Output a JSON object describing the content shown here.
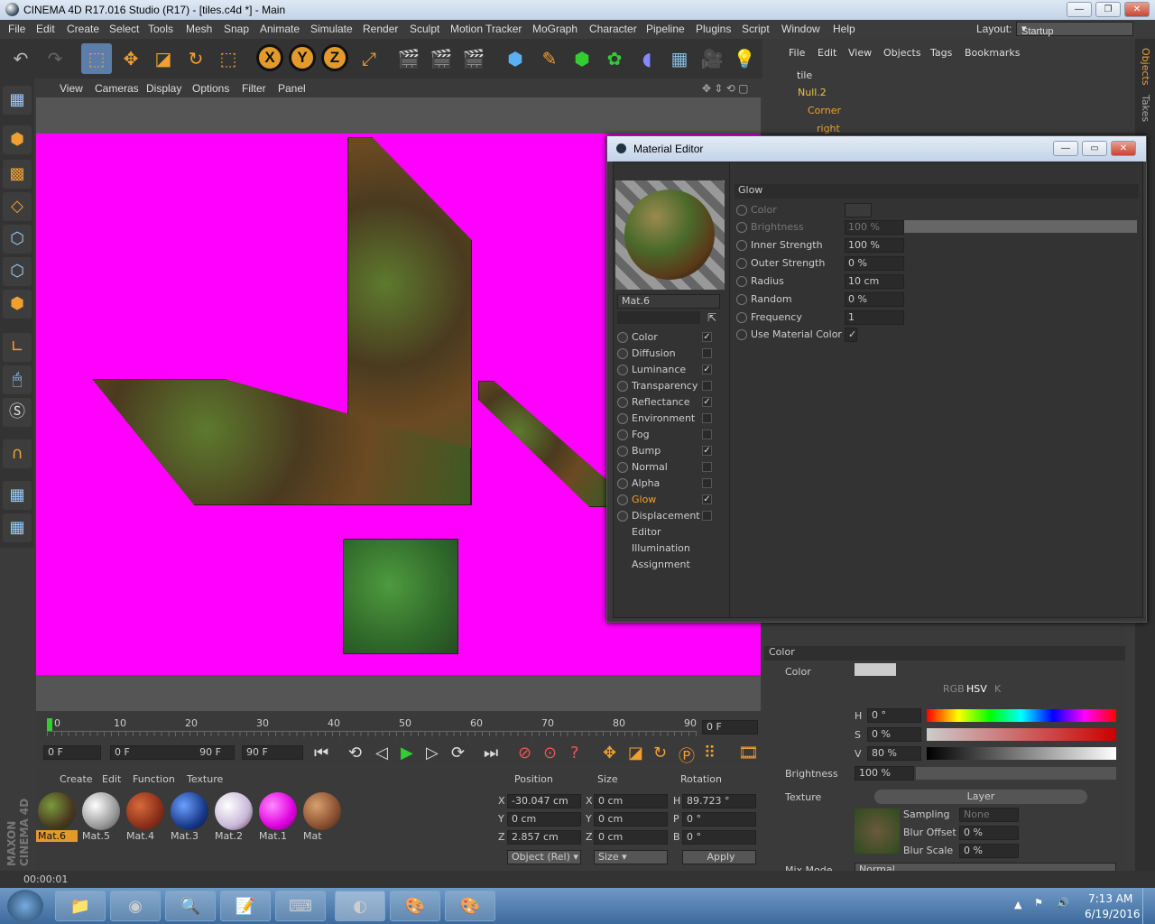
{
  "window": {
    "title": "CINEMA 4D R17.016 Studio (R17) - [tiles.c4d *] - Main"
  },
  "menubar": {
    "items": [
      "File",
      "Edit",
      "Create",
      "Select",
      "Tools",
      "Mesh",
      "Snap",
      "Animate",
      "Simulate",
      "Render",
      "Sculpt",
      "Motion Tracker",
      "MoGraph",
      "Character",
      "Pipeline",
      "Plugins",
      "Script",
      "Window",
      "Help"
    ],
    "layout_label": "Layout:",
    "layout_value": "Startup"
  },
  "viewport": {
    "menu": [
      "View",
      "Cameras",
      "Display",
      "Options",
      "Filter",
      "Panel"
    ],
    "bg_color": "#ff00ff"
  },
  "objects": {
    "menu": [
      "File",
      "Edit",
      "View",
      "Objects",
      "Tags",
      "Bookmarks"
    ],
    "items": [
      "tile",
      "Null.2",
      "Corner",
      "right"
    ]
  },
  "timeline": {
    "ticks": [
      "0",
      "10",
      "20",
      "30",
      "40",
      "50",
      "60",
      "70",
      "80",
      "90"
    ],
    "current_field": "0 F",
    "start": "0 F",
    "range_start": "0 F",
    "range_end": "90 F",
    "end": "90 F"
  },
  "materials": {
    "menu": [
      "Create",
      "Edit",
      "Function",
      "Texture"
    ],
    "items": [
      "Mat.6",
      "Mat.5",
      "Mat.4",
      "Mat.3",
      "Mat.2",
      "Mat.1",
      "Mat"
    ]
  },
  "coords": {
    "headers": [
      "Position",
      "Size",
      "Rotation"
    ],
    "rows": [
      {
        "a": "X",
        "pos": "-30.047 cm",
        "b": "X",
        "size": "0 cm",
        "c": "H",
        "rot": "89.723 °"
      },
      {
        "a": "Y",
        "pos": "0 cm",
        "b": "Y",
        "size": "0 cm",
        "c": "P",
        "rot": "0 °"
      },
      {
        "a": "Z",
        "pos": "2.857 cm",
        "b": "Z",
        "size": "0 cm",
        "c": "B",
        "rot": "0 °"
      }
    ],
    "mode": "Object (Rel)",
    "size_mode": "Size",
    "apply": "Apply"
  },
  "status": {
    "text": "00:00:01"
  },
  "brand": "MAXON CINEMA 4D",
  "material_editor": {
    "title": "Material Editor",
    "mat_name": "Mat.6",
    "channels": [
      {
        "name": "Color",
        "checked": "✓"
      },
      {
        "name": "Diffusion",
        "checked": ""
      },
      {
        "name": "Luminance",
        "checked": "✓"
      },
      {
        "name": "Transparency",
        "checked": ""
      },
      {
        "name": "Reflectance",
        "checked": "✓"
      },
      {
        "name": "Environment",
        "checked": ""
      },
      {
        "name": "Fog",
        "checked": ""
      },
      {
        "name": "Bump",
        "checked": "✓"
      },
      {
        "name": "Normal",
        "checked": ""
      },
      {
        "name": "Alpha",
        "checked": ""
      },
      {
        "name": "Glow",
        "checked": "✓"
      },
      {
        "name": "Displacement",
        "checked": ""
      }
    ],
    "extra": [
      "Editor",
      "Illumination",
      "Assignment"
    ],
    "section": "Glow",
    "params": [
      {
        "name": "Color",
        "value": ""
      },
      {
        "name": "Brightness",
        "value": "100 %"
      },
      {
        "name": "Inner Strength",
        "value": "100 %"
      },
      {
        "name": "Outer Strength",
        "value": "0 %"
      },
      {
        "name": "Radius",
        "value": "10 cm"
      },
      {
        "name": "Random",
        "value": "0 %"
      },
      {
        "name": "Frequency",
        "value": "1"
      },
      {
        "name": "Use Material Color",
        "value": "✓"
      }
    ]
  },
  "attributes": {
    "section": "Color",
    "color_label": "Color",
    "h": "0 °",
    "s": "0 %",
    "v": "80 %",
    "brightness_label": "Brightness",
    "brightness": "100 %",
    "texture_label": "Texture",
    "texture_btn": "Layer",
    "sampling_label": "Sampling",
    "sampling": "None",
    "blur_offset_label": "Blur Offset",
    "blur_offset": "0 %",
    "blur_scale_label": "Blur Scale",
    "blur_scale": "0 %",
    "mix_mode_label": "Mix Mode",
    "mix_mode": "Normal",
    "modes": [
      "RGB",
      "HSV",
      "K"
    ]
  },
  "side_tabs": [
    "Objects",
    "Takes"
  ],
  "clock": {
    "time": "7:13 AM",
    "date": "6/19/2016"
  }
}
